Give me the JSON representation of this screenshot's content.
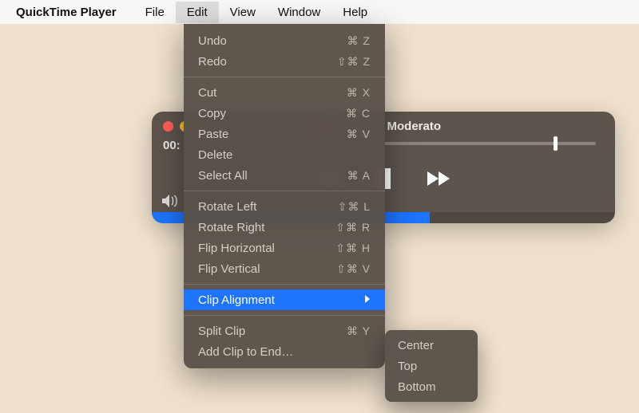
{
  "menubar": {
    "app": "QuickTime Player",
    "items": [
      "File",
      "Edit",
      "View",
      "Window",
      "Help"
    ],
    "open_index": 1
  },
  "player": {
    "title": "Impact Moderato",
    "timecode": "00:",
    "progress_pct": 60
  },
  "edit_menu": {
    "groups": [
      [
        {
          "label": "Undo",
          "shortcut": "⌘ Z"
        },
        {
          "label": "Redo",
          "shortcut": "⇧⌘ Z"
        }
      ],
      [
        {
          "label": "Cut",
          "shortcut": "⌘ X"
        },
        {
          "label": "Copy",
          "shortcut": "⌘ C"
        },
        {
          "label": "Paste",
          "shortcut": "⌘ V"
        },
        {
          "label": "Delete",
          "shortcut": ""
        },
        {
          "label": "Select All",
          "shortcut": "⌘ A"
        }
      ],
      [
        {
          "label": "Rotate Left",
          "shortcut": "⇧⌘ L"
        },
        {
          "label": "Rotate Right",
          "shortcut": "⇧⌘ R"
        },
        {
          "label": "Flip Horizontal",
          "shortcut": "⇧⌘ H"
        },
        {
          "label": "Flip Vertical",
          "shortcut": "⇧⌘ V"
        }
      ],
      [
        {
          "label": "Clip Alignment",
          "shortcut": "",
          "submenu": true,
          "highlight": true
        }
      ],
      [
        {
          "label": "Split Clip",
          "shortcut": "⌘ Y"
        },
        {
          "label": "Add Clip to End…",
          "shortcut": ""
        }
      ]
    ]
  },
  "clip_alignment_submenu": {
    "items": [
      "Center",
      "Top",
      "Bottom"
    ]
  }
}
